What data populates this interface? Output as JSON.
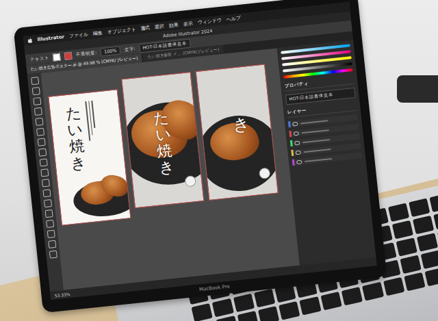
{
  "window": {
    "title": "Adobe Illustrator 2024"
  },
  "menu": {
    "app": "Illustrator",
    "items": [
      "ファイル",
      "編集",
      "オブジェクト",
      "書式",
      "選択",
      "効果",
      "表示",
      "ウィンドウ",
      "ヘルプ"
    ]
  },
  "control_bar": {
    "label": "テキスト",
    "opacity_label": "不透明度:",
    "opacity": "100%",
    "char_label": "文字:",
    "font": "HOT-日本語書体見本"
  },
  "tabs": [
    {
      "label": "たい焼き広告ポスター.ai @ 49.98 % (CMYK/プレビュー)",
      "selected": true
    },
    {
      "label": "たい焼き屋様 メ… (CMYK/プレビュー)",
      "selected": false
    }
  ],
  "artboards": [
    {
      "kind": "poster",
      "title": "たい焼き"
    },
    {
      "kind": "closeup",
      "title": "たい焼き"
    },
    {
      "kind": "partial",
      "title": "き"
    }
  ],
  "panels": {
    "properties": {
      "title": "プロパティ",
      "font": "HOT-日本語書体見本"
    },
    "layers": {
      "title": "レイヤー"
    }
  },
  "status": {
    "zoom": "53.33%"
  },
  "laptop": {
    "model": "MacBook Pro"
  }
}
